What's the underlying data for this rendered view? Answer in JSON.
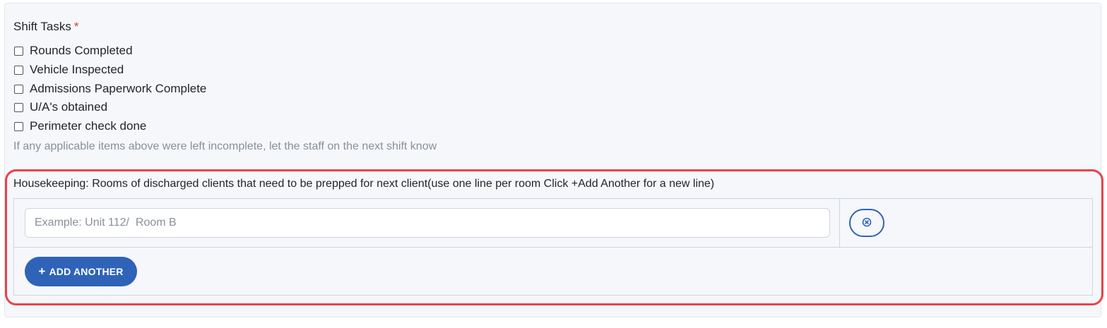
{
  "shift_tasks": {
    "label": "Shift Tasks",
    "required_marker": "*",
    "options": [
      {
        "label": "Rounds Completed",
        "checked": false
      },
      {
        "label": "Vehicle Inspected",
        "checked": false
      },
      {
        "label": "Admissions Paperwork Complete",
        "checked": false
      },
      {
        "label": "U/A's obtained",
        "checked": false
      },
      {
        "label": "Perimeter check done",
        "checked": false
      }
    ],
    "help_text": "If any applicable items above were left incomplete, let the staff on the next shift know"
  },
  "housekeeping": {
    "label": "Housekeeping: Rooms of discharged clients that need to be prepped for next client(use one line per room Click +Add Another for a new line)",
    "rows": [
      {
        "value": "",
        "placeholder": "Example: Unit 112/  Room B"
      }
    ],
    "remove_icon": "close-circle-icon",
    "add_button": {
      "icon": "plus-icon",
      "icon_glyph": "+",
      "label": "ADD ANOTHER"
    }
  },
  "colors": {
    "panel_bg": "#f5f7fb",
    "accent": "#2f63b8",
    "required": "#d9342b",
    "highlight_outline": "#e9434a",
    "muted_text": "#8a9099"
  }
}
